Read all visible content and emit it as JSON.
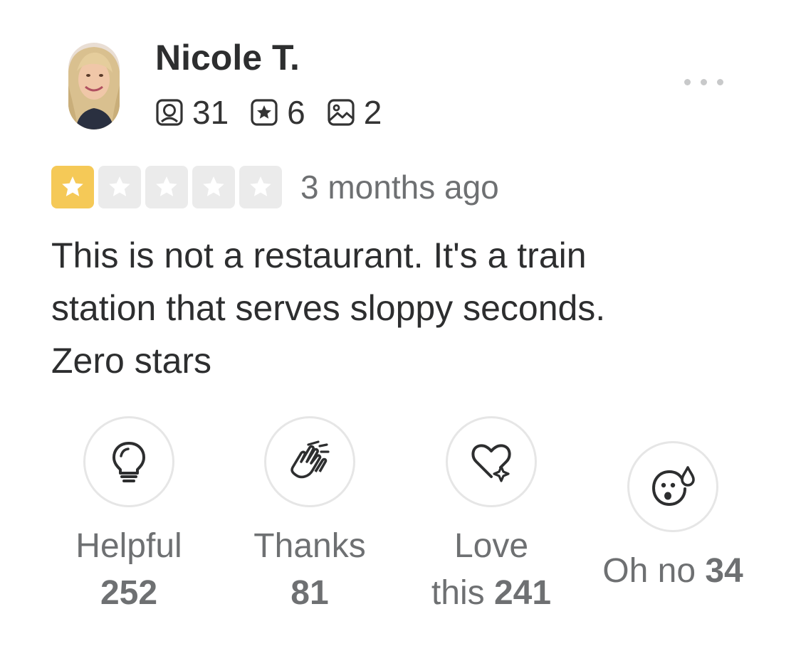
{
  "review": {
    "user": {
      "name": "Nicole T.",
      "stats": [
        {
          "icon": "friends-icon",
          "value": "31"
        },
        {
          "icon": "reviews-star-icon",
          "value": "6"
        },
        {
          "icon": "photos-icon",
          "value": "2"
        }
      ]
    },
    "rating": {
      "stars": 1,
      "max_stars": 5,
      "date": "3 months ago"
    },
    "text_lines": [
      "This is not a restaurant. It's a train",
      "station that serves sloppy seconds.",
      "Zero stars"
    ],
    "reactions": [
      {
        "icon": "lightbulb-icon",
        "label": "Helpful",
        "count": "252"
      },
      {
        "icon": "clapping-hands-icon",
        "label": "Thanks",
        "count": "81"
      },
      {
        "icon": "heart-sparkle-icon",
        "label_line1": "Love",
        "label_line2": "this",
        "count": "241"
      },
      {
        "icon": "oh-no-face-icon",
        "label": "Oh no",
        "count": "34"
      }
    ]
  },
  "colors": {
    "star_filled": "#f5c957",
    "star_empty": "#ebebeb",
    "text_primary": "#2d2e2f",
    "text_secondary": "#6e7072",
    "circle_border": "#e6e6e6"
  }
}
